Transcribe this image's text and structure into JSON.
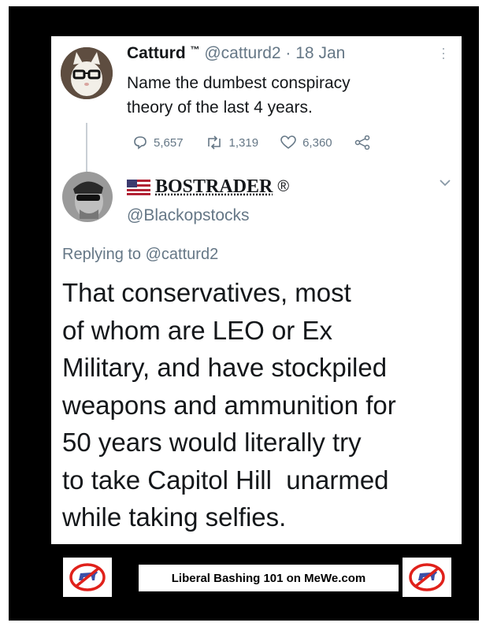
{
  "tweet": {
    "author_name": "Catturd",
    "trademark": "™",
    "handle": "@catturd2",
    "separator": "·",
    "date": "18 Jan",
    "text_lines": [
      "Name the dumbest conspiracy",
      "theory of the last 4 years."
    ],
    "replies": "5,657",
    "retweets": "1,319",
    "likes": "6,360",
    "more_icon": "vertical-dots-icon",
    "share_icon": "share-icon"
  },
  "reply": {
    "flag_icon": "us-flag-icon",
    "author_name": "BOSTRADER",
    "registered_mark": "®",
    "handle": "@Blackopstocks",
    "replying_prefix": "Replying to",
    "replying_to": "@catturd2",
    "text_lines": [
      "That conservatives, most",
      "of whom are LEO or Ex",
      "Military, and have stockpiled",
      "weapons and ammunition for",
      "50 years would literally try",
      "to take Capitol Hill  unarmed",
      "while taking selfies."
    ],
    "menu_icon": "chevron-down-icon"
  },
  "footer": {
    "banner_text": "Liberal Bashing 101 on MeWe.com",
    "logo_left": "no-donkey-icon",
    "logo_right": "no-donkey-icon"
  },
  "colors": {
    "frame": "#000000",
    "text": "#14171a",
    "muted": "#657786",
    "link": "#657786",
    "no_symbol": "#e0211b",
    "donkey": "#3a4fa8"
  }
}
